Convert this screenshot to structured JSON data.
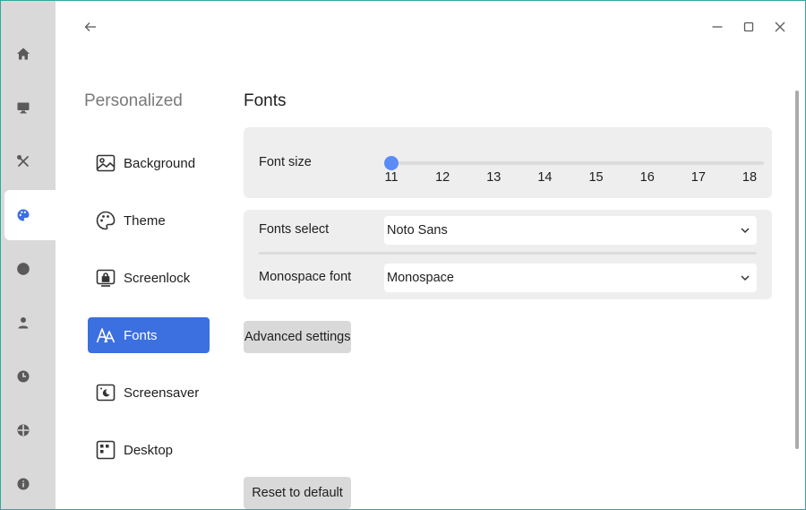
{
  "window": {
    "border_color": "#2fa8a0",
    "accent": "#3c6fe0"
  },
  "rail": {
    "items": [
      {
        "icon": "home-icon"
      },
      {
        "icon": "display-icon"
      },
      {
        "icon": "tools-icon"
      },
      {
        "icon": "palette-icon",
        "active": true
      },
      {
        "icon": "network-icon"
      },
      {
        "icon": "user-icon"
      },
      {
        "icon": "clock-icon"
      },
      {
        "icon": "update-icon"
      },
      {
        "icon": "info-icon"
      }
    ]
  },
  "sidebar": {
    "title": "Personalized",
    "items": [
      {
        "label": "Background",
        "icon": "image-icon"
      },
      {
        "label": "Theme",
        "icon": "palette-icon"
      },
      {
        "label": "Screenlock",
        "icon": "screenlock-icon"
      },
      {
        "label": "Fonts",
        "icon": "fonts-icon",
        "active": true
      },
      {
        "label": "Screensaver",
        "icon": "screensaver-icon"
      },
      {
        "label": "Desktop",
        "icon": "desktop-grid-icon"
      }
    ]
  },
  "main": {
    "title": "Fonts",
    "font_size": {
      "label": "Font size",
      "ticks": [
        "11",
        "12",
        "13",
        "14",
        "15",
        "16",
        "17",
        "18"
      ],
      "value": 11,
      "min": 11,
      "max": 18
    },
    "fonts_select": {
      "label": "Fonts select",
      "value": "Noto Sans"
    },
    "monospace_font": {
      "label": "Monospace font",
      "value": "Monospace"
    },
    "advanced_button": "Advanced settings",
    "reset_button": "Reset to default"
  }
}
